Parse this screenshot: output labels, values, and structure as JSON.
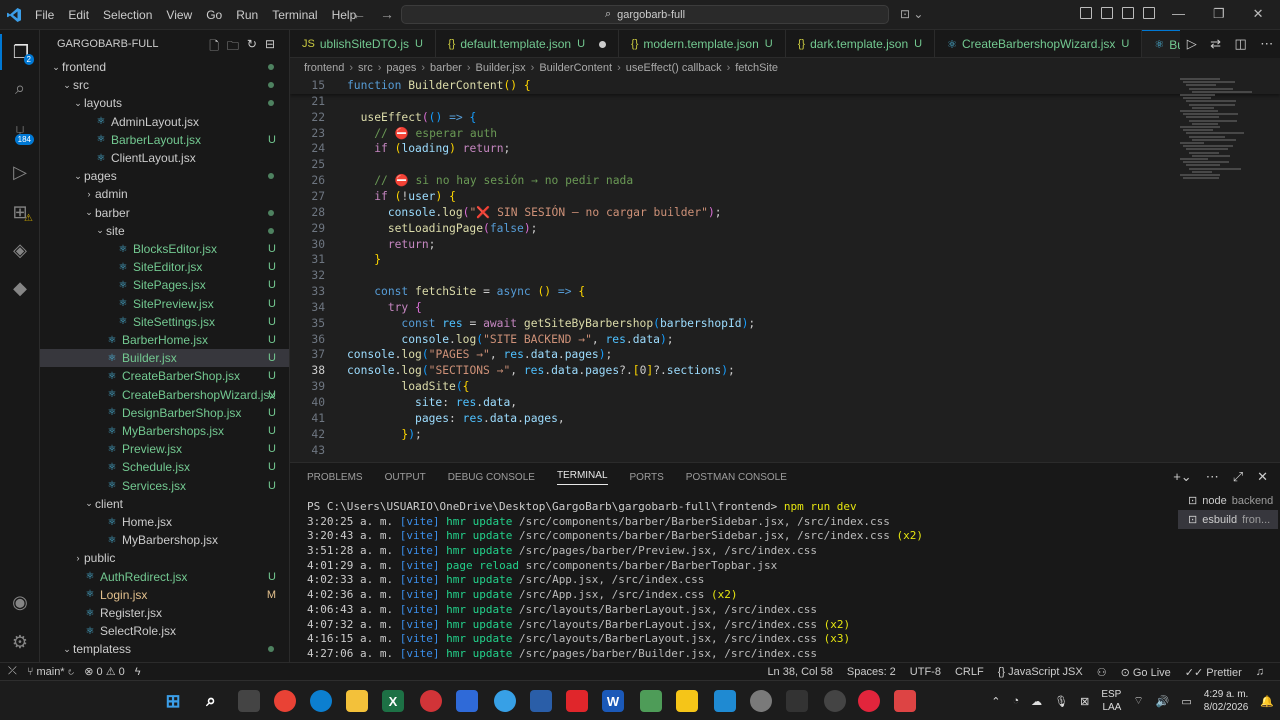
{
  "window": {
    "menu": [
      "File",
      "Edit",
      "Selection",
      "View",
      "Go",
      "Run",
      "Terminal",
      "Help"
    ],
    "search_text": "gargobarb-full"
  },
  "activity_bar": {
    "explorer_badge": "2",
    "scm_badge": "184"
  },
  "explorer": {
    "title": "GARGOBARB-FULL",
    "items": [
      {
        "label": "frontend",
        "depth": 0,
        "type": "folder",
        "open": true,
        "status": "dot",
        "y": 0
      },
      {
        "label": "src",
        "depth": 1,
        "type": "folder",
        "open": true,
        "status": "dot",
        "y": 1
      },
      {
        "label": "layouts",
        "depth": 2,
        "type": "folder",
        "open": true,
        "status": "dot",
        "y": 2
      },
      {
        "label": "AdminLayout.jsx",
        "depth": 3,
        "type": "file",
        "status": "",
        "y": 3
      },
      {
        "label": "BarberLayout.jsx",
        "depth": 3,
        "type": "file",
        "status": "U",
        "y": 4
      },
      {
        "label": "ClientLayout.jsx",
        "depth": 3,
        "type": "file",
        "status": "",
        "y": 5
      },
      {
        "label": "pages",
        "depth": 2,
        "type": "folder",
        "open": true,
        "status": "dot",
        "y": 6
      },
      {
        "label": "admin",
        "depth": 3,
        "type": "folder",
        "open": false,
        "status": "",
        "y": 7
      },
      {
        "label": "barber",
        "depth": 3,
        "type": "folder",
        "open": true,
        "status": "dot",
        "y": 8
      },
      {
        "label": "site",
        "depth": 4,
        "type": "folder",
        "open": true,
        "status": "dot",
        "y": 9
      },
      {
        "label": "BlocksEditor.jsx",
        "depth": 5,
        "type": "file",
        "status": "U",
        "y": 10
      },
      {
        "label": "SiteEditor.jsx",
        "depth": 5,
        "type": "file",
        "status": "U",
        "y": 11
      },
      {
        "label": "SitePages.jsx",
        "depth": 5,
        "type": "file",
        "status": "U",
        "y": 12
      },
      {
        "label": "SitePreview.jsx",
        "depth": 5,
        "type": "file",
        "status": "U",
        "y": 13
      },
      {
        "label": "SiteSettings.jsx",
        "depth": 5,
        "type": "file",
        "status": "U",
        "y": 14
      },
      {
        "label": "BarberHome.jsx",
        "depth": 4,
        "type": "file",
        "status": "U",
        "y": 15
      },
      {
        "label": "Builder.jsx",
        "depth": 4,
        "type": "file",
        "status": "U",
        "y": 16,
        "selected": true
      },
      {
        "label": "CreateBarberShop.jsx",
        "depth": 4,
        "type": "file",
        "status": "U",
        "y": 17
      },
      {
        "label": "CreateBarbershopWizard.jsx",
        "depth": 4,
        "type": "file",
        "status": "U",
        "y": 18
      },
      {
        "label": "DesignBarberShop.jsx",
        "depth": 4,
        "type": "file",
        "status": "U",
        "y": 19
      },
      {
        "label": "MyBarbershops.jsx",
        "depth": 4,
        "type": "file",
        "status": "U",
        "y": 20
      },
      {
        "label": "Preview.jsx",
        "depth": 4,
        "type": "file",
        "status": "U",
        "y": 21
      },
      {
        "label": "Schedule.jsx",
        "depth": 4,
        "type": "file",
        "status": "U",
        "y": 22
      },
      {
        "label": "Services.jsx",
        "depth": 4,
        "type": "file",
        "status": "U",
        "y": 23
      },
      {
        "label": "client",
        "depth": 3,
        "type": "folder",
        "open": true,
        "status": "",
        "y": 24
      },
      {
        "label": "Home.jsx",
        "depth": 4,
        "type": "file",
        "status": "",
        "y": 25
      },
      {
        "label": "MyBarbershop.jsx",
        "depth": 4,
        "type": "file",
        "status": "",
        "y": 26
      },
      {
        "label": "public",
        "depth": 2,
        "type": "folder",
        "open": false,
        "status": "",
        "y": 27
      },
      {
        "label": "AuthRedirect.jsx",
        "depth": 2,
        "type": "file",
        "status": "U",
        "y": 28
      },
      {
        "label": "Login.jsx",
        "depth": 2,
        "type": "file",
        "status": "M",
        "y": 29
      },
      {
        "label": "Register.jsx",
        "depth": 2,
        "type": "file",
        "status": "",
        "y": 30
      },
      {
        "label": "SelectRole.jsx",
        "depth": 2,
        "type": "file",
        "status": "",
        "y": 31
      },
      {
        "label": "templatess",
        "depth": 1,
        "type": "folder",
        "open": true,
        "status": "dot",
        "y": 32
      }
    ]
  },
  "tabs": [
    {
      "label": "ublishSiteDTO.js",
      "status": "U",
      "icon": "JS"
    },
    {
      "label": "default.template.json",
      "status": "U",
      "icon": "{}",
      "dirty": true
    },
    {
      "label": "modern.template.json",
      "status": "U",
      "icon": "{}"
    },
    {
      "label": "dark.template.json",
      "status": "U",
      "icon": "{}"
    },
    {
      "label": "CreateBarbershopWizard.jsx",
      "status": "U",
      "icon": "⚛"
    },
    {
      "label": "Builder.jsx",
      "status": "U",
      "icon": "⚛",
      "active": true
    }
  ],
  "breadcrumb": [
    "frontend",
    "src",
    "pages",
    "barber",
    "Builder.jsx",
    "BuilderContent",
    "useEffect() callback",
    "fetchSite"
  ],
  "editor": {
    "current_line": "38",
    "lines": [
      {
        "n": "15",
        "html": "<span class=\"kw\">function</span> <span class=\"fn\">BuilderContent</span><span class=\"br\">()</span> <span class=\"br\">{</span>",
        "sticky": true
      },
      {
        "n": "21",
        "html": ""
      },
      {
        "n": "22",
        "html": "  <span class=\"fn\">useEffect</span><span class=\"br2\">(</span><span class=\"br3\">()</span> <span class=\"kw\">=&gt;</span> <span class=\"br3\">{</span>"
      },
      {
        "n": "23",
        "html": "    <span class=\"com\">// ⛔ esperar auth</span>"
      },
      {
        "n": "24",
        "html": "    <span class=\"kw2\">if</span> <span class=\"br\">(</span><span class=\"var\">loading</span><span class=\"br\">)</span> <span class=\"kw2\">return</span>;"
      },
      {
        "n": "25",
        "html": ""
      },
      {
        "n": "26",
        "html": "    <span class=\"com\">// ⛔ si no hay sesión → no pedir nada</span>"
      },
      {
        "n": "27",
        "html": "    <span class=\"kw2\">if</span> <span class=\"br\">(</span>!<span class=\"var\">user</span><span class=\"br\">)</span> <span class=\"br\">{</span>"
      },
      {
        "n": "28",
        "html": "      <span class=\"var\">console</span>.<span class=\"fn\">log</span><span class=\"br2\">(</span><span class=\"str\">\"❌ SIN SESIÓN — no cargar builder\"</span><span class=\"br2\">)</span>;"
      },
      {
        "n": "29",
        "html": "      <span class=\"fn\">setLoadingPage</span><span class=\"br2\">(</span><span class=\"kw\">false</span><span class=\"br2\">)</span>;"
      },
      {
        "n": "30",
        "html": "      <span class=\"kw2\">return</span>;"
      },
      {
        "n": "31",
        "html": "    <span class=\"br\">}</span>"
      },
      {
        "n": "32",
        "html": ""
      },
      {
        "n": "33",
        "html": "    <span class=\"kw\">const</span> <span class=\"fn\">fetchSite</span> = <span class=\"kw\">async</span> <span class=\"br\">()</span> <span class=\"kw\">=&gt;</span> <span class=\"br\">{</span>"
      },
      {
        "n": "34",
        "html": "      <span class=\"kw2\">try</span> <span class=\"br2\">{</span>"
      },
      {
        "n": "35",
        "html": "        <span class=\"kw\">const</span> <span class=\"cst\">res</span> = <span class=\"kw2\">await</span> <span class=\"fn\">getSiteByBarbershop</span><span class=\"br3\">(</span><span class=\"var\">barbershopId</span><span class=\"br3\">)</span>;"
      },
      {
        "n": "36",
        "html": "        <span class=\"var\">console</span>.<span class=\"fn\">log</span><span class=\"br3\">(</span><span class=\"str\">\"SITE BACKEND →\"</span>, <span class=\"cst\">res</span>.<span class=\"var\">data</span><span class=\"br3\">)</span>;"
      },
      {
        "n": "37",
        "html": "<span class=\"var\">console</span>.<span class=\"fn\">log</span><span class=\"br3\">(</span><span class=\"str\">\"PAGES →\"</span>, <span class=\"cst\">res</span>.<span class=\"var\">data</span>.<span class=\"var\">pages</span><span class=\"br3\">)</span>;"
      },
      {
        "n": "38",
        "html": "<span class=\"var\">console</span>.<span class=\"fn\">log</span><span class=\"br3\">(</span><span class=\"str\">\"SECTIONS →\"</span>, <span class=\"cst\">res</span>.<span class=\"var\">data</span>.<span class=\"var\">pages</span>?.<span class=\"br\">[</span>0<span class=\"br\">]</span>?.<span class=\"var\">sections</span><span class=\"br3\">)</span>;"
      },
      {
        "n": "39",
        "html": "        <span class=\"fn\">loadSite</span><span class=\"br3\">(</span><span class=\"br\">{</span>"
      },
      {
        "n": "40",
        "html": "          <span class=\"var\">site</span>: <span class=\"cst\">res</span>.<span class=\"var\">data</span>,"
      },
      {
        "n": "41",
        "html": "          <span class=\"var\">pages</span>: <span class=\"cst\">res</span>.<span class=\"var\">data</span>.<span class=\"var\">pages</span>,"
      },
      {
        "n": "42",
        "html": "        <span class=\"br\">}</span><span class=\"br3\">)</span>;"
      },
      {
        "n": "43",
        "html": ""
      }
    ]
  },
  "panel": {
    "tabs": [
      "PROBLEMS",
      "OUTPUT",
      "DEBUG CONSOLE",
      "TERMINAL",
      "PORTS",
      "POSTMAN CONSOLE"
    ],
    "active_tab": "TERMINAL",
    "prompt": "PS C:\\Users\\USUARIO\\OneDrive\\Desktop\\GargoBarb\\gargobarb-full\\frontend>",
    "command": "npm run dev",
    "log": [
      {
        "time": "3:20:25 a. m.",
        "action": "hmr update",
        "path": "/src/components/barber/BarberSidebar.jsx, /src/index.css",
        "count": ""
      },
      {
        "time": "3:20:43 a. m.",
        "action": "hmr update",
        "path": "/src/components/barber/BarberSidebar.jsx, /src/index.css",
        "count": "(x2)"
      },
      {
        "time": "3:51:28 a. m.",
        "action": "hmr update",
        "path": "/src/pages/barber/Preview.jsx, /src/index.css",
        "count": ""
      },
      {
        "time": "4:01:29 a. m.",
        "action": "page reload",
        "path": "src/components/barber/BarberTopbar.jsx",
        "count": ""
      },
      {
        "time": "4:02:33 a. m.",
        "action": "hmr update",
        "path": "/src/App.jsx, /src/index.css",
        "count": ""
      },
      {
        "time": "4:02:36 a. m.",
        "action": "hmr update",
        "path": "/src/App.jsx, /src/index.css",
        "count": "(x2)"
      },
      {
        "time": "4:06:43 a. m.",
        "action": "hmr update",
        "path": "/src/layouts/BarberLayout.jsx, /src/index.css",
        "count": ""
      },
      {
        "time": "4:07:32 a. m.",
        "action": "hmr update",
        "path": "/src/layouts/BarberLayout.jsx, /src/index.css",
        "count": "(x2)"
      },
      {
        "time": "4:16:15 a. m.",
        "action": "hmr update",
        "path": "/src/layouts/BarberLayout.jsx, /src/index.css",
        "count": "(x3)"
      },
      {
        "time": "4:27:06 a. m.",
        "action": "hmr update",
        "path": "/src/pages/barber/Builder.jsx, /src/index.css",
        "count": ""
      }
    ],
    "vite_tag": "[vite]",
    "terminals": [
      {
        "name": "node",
        "sub": "backend"
      },
      {
        "name": "esbuild",
        "sub": "fron..."
      }
    ]
  },
  "status": {
    "branch": "main*",
    "errors": "0",
    "warnings": "0",
    "position": "Ln 38, Col 58",
    "spaces": "Spaces: 2",
    "encoding": "UTF-8",
    "eol": "CRLF",
    "language": "JavaScript JSX",
    "golive": "Go Live",
    "prettier": "Prettier"
  },
  "taskbar": {
    "lang": "ESP",
    "lang2": "LAA",
    "time": "4:29 a. m.",
    "date": "8/02/2026"
  },
  "colors": {
    "accent": "#0078d4",
    "untracked": "#73c991",
    "modified": "#e2c08d"
  }
}
